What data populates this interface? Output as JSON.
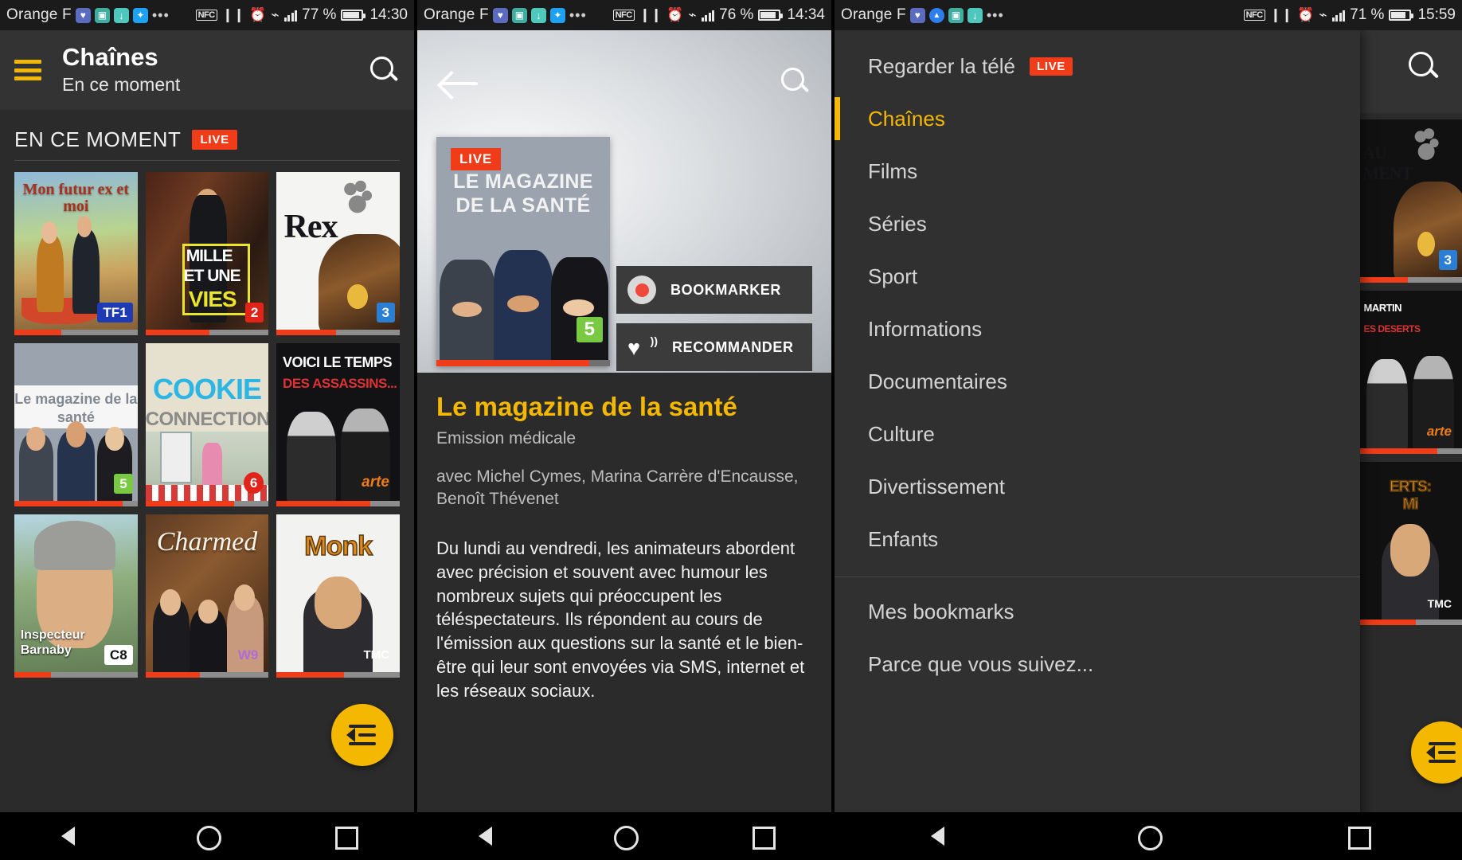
{
  "panels": [
    {
      "id": "channels-grid",
      "statusbar": {
        "carrier": "Orange F",
        "icons": [
          "heart-rate-icon",
          "photo-icon",
          "download-icon",
          "twitter-icon",
          "overflow-dots-icon"
        ],
        "nfc": "NFC",
        "right_icons": [
          "vibrate-icon",
          "alarm-icon",
          "wifi-icon",
          "signal-bars-icon"
        ],
        "battery_percent": "77 %",
        "time": "14:30"
      },
      "appbar": {
        "menu_icon": "hamburger-icon",
        "title": "Chaînes",
        "subtitle": "En ce moment",
        "search_icon": "search-icon"
      },
      "section": {
        "title": "EN CE MOMENT",
        "badge": "LIVE"
      },
      "tiles": [
        {
          "title": "Mon futur ex et moi",
          "channel": "TF1",
          "progress": 38
        },
        {
          "title": "Mille et une vies",
          "channel": "2",
          "progress": 52
        },
        {
          "title": "Rex",
          "channel": "3",
          "progress": 48
        },
        {
          "title": "Le magazine de la santé",
          "channel": "5",
          "progress": 88
        },
        {
          "title": "Cookie Connection",
          "channel": "6",
          "progress": 72
        },
        {
          "title": "Voici le temps des assassins...",
          "channel": "arte",
          "progress": 76
        },
        {
          "title": "Inspecteur Barnaby",
          "channel": "C8",
          "progress": 30
        },
        {
          "title": "Charmed",
          "channel": "W9",
          "progress": 44
        },
        {
          "title": "Monk",
          "channel": "TMC",
          "progress": 55
        }
      ],
      "fab": "list-fab-icon"
    },
    {
      "id": "program-detail",
      "statusbar": {
        "carrier": "Orange F",
        "nfc": "NFC",
        "battery_percent": "76 %",
        "time": "14:34"
      },
      "hero": {
        "back_icon": "back-arrow-icon",
        "search_icon": "search-icon"
      },
      "poster": {
        "live_badge": "LIVE",
        "title_line1": "LE MAGAZINE",
        "title_line2": "DE LA SANTÉ",
        "channel": "5",
        "progress": 88
      },
      "buttons": [
        {
          "label": "BOOKMARKER",
          "icon": "record-dot-icon"
        },
        {
          "label": "RECOMMANDER",
          "icon": "heart-broadcast-icon"
        }
      ],
      "detail": {
        "title": "Le magazine de la santé",
        "genre": "Emission médicale",
        "cast": "avec Michel Cymes, Marina Carrère d'Encausse, Benoît Thévenet",
        "description": "Du lundi au vendredi, les animateurs abordent avec précision et souvent avec humour les nombreux sujets qui préoccupent les téléspectateurs. Ils répondent au cours de l'émission aux questions sur la santé et le bien-être qui leur sont envoyées via SMS, internet et les réseaux sociaux."
      }
    },
    {
      "id": "navigation-drawer",
      "statusbar": {
        "carrier": "Orange F",
        "nfc": "NFC",
        "battery_percent": "71 %",
        "time": "15:59"
      },
      "drawer": {
        "items": [
          {
            "label": "Regarder la télé",
            "badge": "LIVE",
            "active": false
          },
          {
            "label": "Chaînes",
            "badge": "",
            "active": true
          },
          {
            "label": "Films",
            "badge": "",
            "active": false
          },
          {
            "label": "Séries",
            "badge": "",
            "active": false
          },
          {
            "label": "Sport",
            "badge": "",
            "active": false
          },
          {
            "label": "Informations",
            "badge": "",
            "active": false
          },
          {
            "label": "Documentaires",
            "badge": "",
            "active": false
          },
          {
            "label": "Culture",
            "badge": "",
            "active": false
          },
          {
            "label": "Divertissement",
            "badge": "",
            "active": false
          },
          {
            "label": "Enfants",
            "badge": "",
            "active": false
          }
        ],
        "footer_items": [
          {
            "label": "Mes bookmarks"
          },
          {
            "label": "Parce que vous suivez..."
          }
        ]
      },
      "background_tiles": [
        {
          "channel": "3",
          "progress": 48
        },
        {
          "channel": "arte",
          "progress": 76
        },
        {
          "channel": "TMC",
          "progress": 55
        }
      ],
      "search_icon": "search-icon",
      "fab": "list-fab-icon"
    }
  ],
  "navbar": {
    "back": "nav-back-icon",
    "home": "nav-home-icon",
    "recents": "nav-recents-icon"
  },
  "colors": {
    "accent": "#f5b800",
    "live_red": "#f03c18",
    "bg_dark": "#2b2b2b",
    "appbar": "#333333"
  }
}
